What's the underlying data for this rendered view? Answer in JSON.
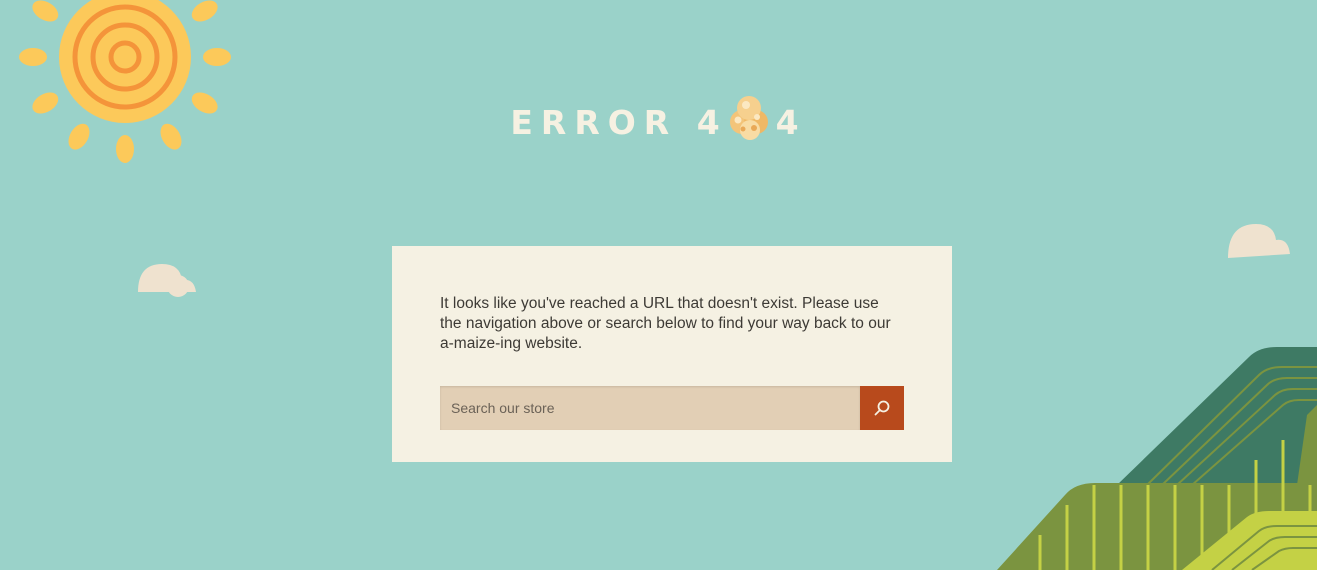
{
  "header": {
    "title_before": "ERROR 4",
    "title_after": "4",
    "title_middle_icon": "popcorn-icon"
  },
  "message": {
    "text": "It looks like you've reached a URL that doesn't exist. Please use the navigation above or search below to find your way back to our a-maize-ing website."
  },
  "search": {
    "placeholder": "Search our store",
    "value": "",
    "button_icon": "search-icon"
  },
  "colors": {
    "sky": "#9ad2c9",
    "card": "#f5f1e3",
    "search_field": "#e2cfb5",
    "search_button": "#b84a1c",
    "sun": "#fcc95a",
    "sun_rings": "#f4943a",
    "hill_dark": "#3e7a64",
    "hill_mid": "#7b9440",
    "hill_light": "#c4d145"
  },
  "decorations": [
    "sun-icon",
    "cloud-icon",
    "cloud-icon",
    "cornfield-hills"
  ]
}
